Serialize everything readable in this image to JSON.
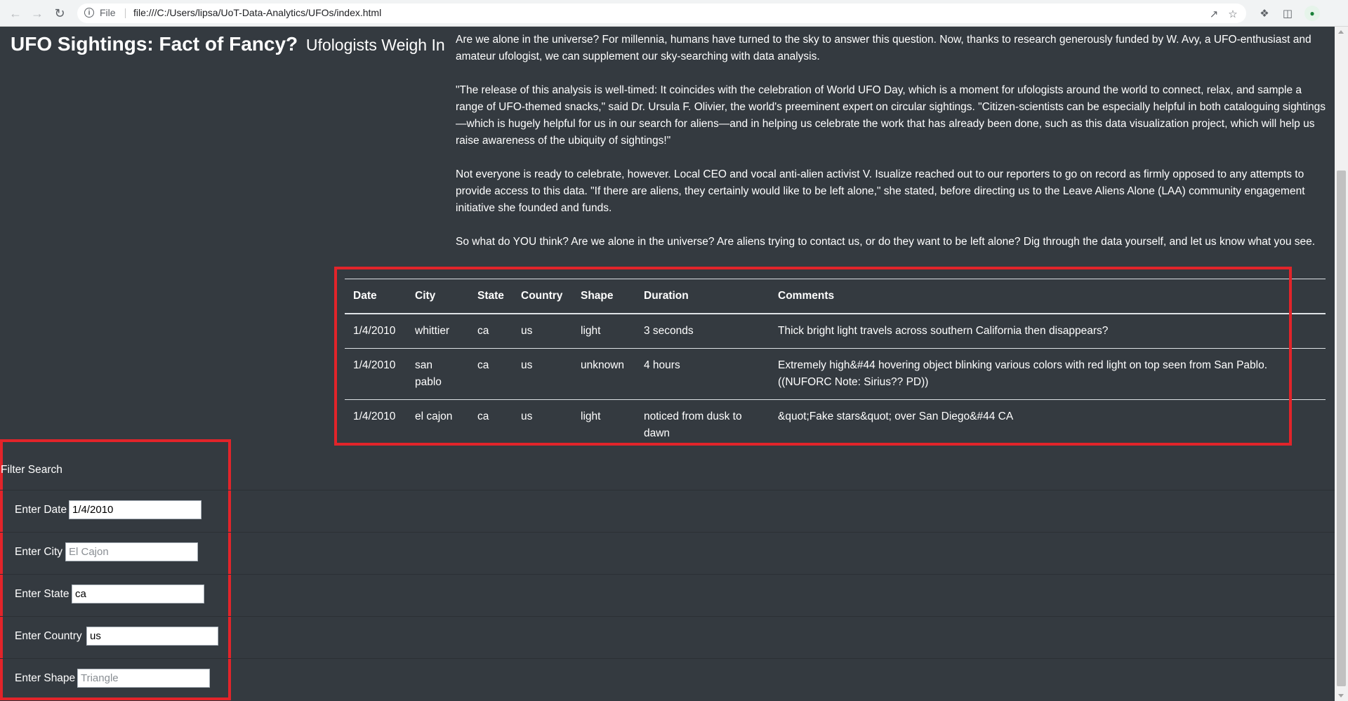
{
  "browser": {
    "scheme_label": "File",
    "url": "file:///C:/Users/lipsa/UoT-Data-Analytics/UFOs/index.html",
    "icons": {
      "back": "arrow-left-icon",
      "forward": "arrow-right-icon",
      "reload": "reload-icon",
      "info": "info-icon",
      "share": "share-icon",
      "bookmark": "star-icon",
      "extensions": "puzzle-icon",
      "side_panel": "side-panel-icon",
      "profile": "profile-icon"
    }
  },
  "page": {
    "title": "UFO Sightings: Fact of Fancy?",
    "subtitle": "Ufologists Weigh In"
  },
  "article": {
    "paragraphs": [
      "Are we alone in the universe? For millennia, humans have turned to the sky to answer this question. Now, thanks to research generously funded by W. Avy, a UFO-enthusiast and amateur ufologist, we can supplement our sky-searching with data analysis.",
      "\"The release of this analysis is well-timed: It coincides with the celebration of World UFO Day, which is a moment for ufologists around the world to connect, relax, and sample a range of UFO-themed snacks,\" said Dr. Ursula F. Olivier, the world's preeminent expert on circular sightings. \"Citizen-scientists can be especially helpful in both cataloguing sightings—which is hugely helpful for us in our search for aliens—and in helping us celebrate the work that has already been done, such as this data visualization project, which will help us raise awareness of the ubiquity of sightings!\"",
      "Not everyone is ready to celebrate, however. Local CEO and vocal anti-alien activist V. Isualize reached out to our reporters to go on record as firmly opposed to any attempts to provide access to this data. \"If there are aliens, they certainly would like to be left alone,\" she stated, before directing us to the Leave Aliens Alone (LAA) community engagement initiative she founded and funds.",
      "So what do YOU think? Are we alone in the universe? Are aliens trying to contact us, or do they want to be left alone? Dig through the data yourself, and let us know what you see."
    ]
  },
  "table": {
    "headers": [
      "Date",
      "City",
      "State",
      "Country",
      "Shape",
      "Duration",
      "Comments"
    ],
    "rows": [
      [
        "1/4/2010",
        "whittier",
        "ca",
        "us",
        "light",
        "3 seconds",
        "Thick bright light travels across southern California then disappears?"
      ],
      [
        "1/4/2010",
        "san pablo",
        "ca",
        "us",
        "unknown",
        "4 hours",
        "Extremely high&#44 hovering object blinking various colors with red light on top seen from San Pablo.  ((NUFORC Note: Sirius?? PD))"
      ],
      [
        "1/4/2010",
        "el cajon",
        "ca",
        "us",
        "light",
        "noticed from dusk to dawn",
        "&quot;Fake stars&quot; over San Diego&#44 CA"
      ]
    ]
  },
  "filter": {
    "title": "Filter Search",
    "fields": [
      {
        "label": "Enter Date",
        "value": "1/4/2010",
        "placeholder": ""
      },
      {
        "label": "Enter City",
        "value": "",
        "placeholder": "El Cajon"
      },
      {
        "label": "Enter State",
        "value": "ca",
        "placeholder": ""
      },
      {
        "label": "Enter Country",
        "value": "us",
        "placeholder": ""
      },
      {
        "label": "Enter Shape",
        "value": "",
        "placeholder": "Triangle"
      }
    ]
  },
  "colors": {
    "background": "#343a40",
    "highlight": "#e2242a",
    "text": "#ffffff"
  }
}
